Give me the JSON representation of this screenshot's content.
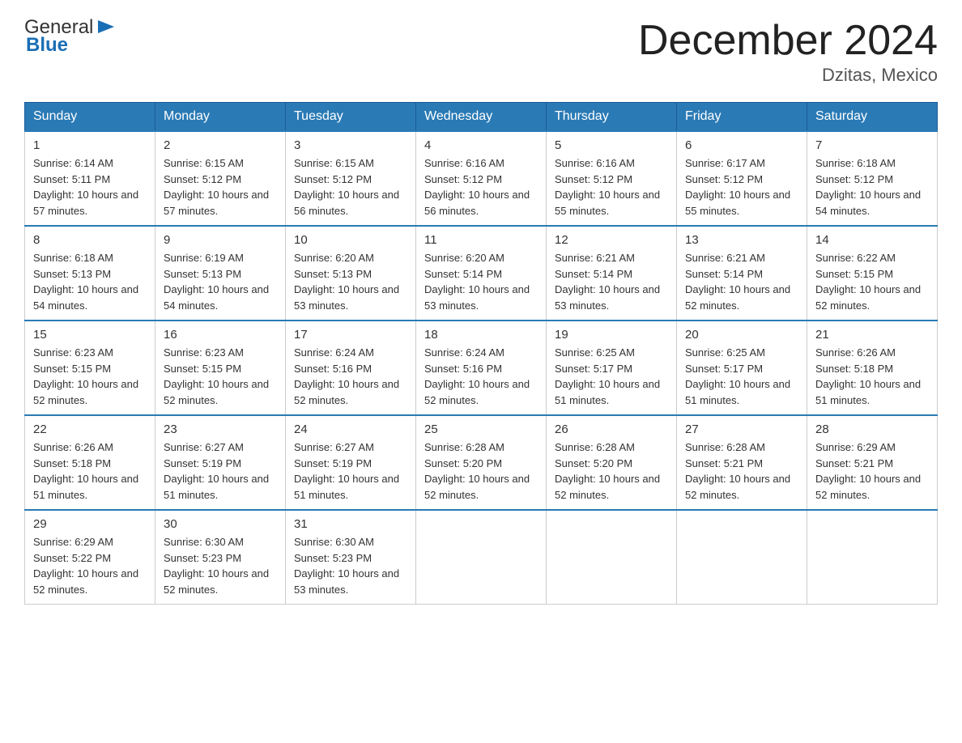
{
  "logo": {
    "general": "General",
    "blue": "Blue",
    "arrow_char": "▶"
  },
  "title": "December 2024",
  "location": "Dzitas, Mexico",
  "headers": [
    "Sunday",
    "Monday",
    "Tuesday",
    "Wednesday",
    "Thursday",
    "Friday",
    "Saturday"
  ],
  "weeks": [
    [
      {
        "day": "1",
        "sunrise": "6:14 AM",
        "sunset": "5:11 PM",
        "daylight": "10 hours and 57 minutes."
      },
      {
        "day": "2",
        "sunrise": "6:15 AM",
        "sunset": "5:12 PM",
        "daylight": "10 hours and 57 minutes."
      },
      {
        "day": "3",
        "sunrise": "6:15 AM",
        "sunset": "5:12 PM",
        "daylight": "10 hours and 56 minutes."
      },
      {
        "day": "4",
        "sunrise": "6:16 AM",
        "sunset": "5:12 PM",
        "daylight": "10 hours and 56 minutes."
      },
      {
        "day": "5",
        "sunrise": "6:16 AM",
        "sunset": "5:12 PM",
        "daylight": "10 hours and 55 minutes."
      },
      {
        "day": "6",
        "sunrise": "6:17 AM",
        "sunset": "5:12 PM",
        "daylight": "10 hours and 55 minutes."
      },
      {
        "day": "7",
        "sunrise": "6:18 AM",
        "sunset": "5:12 PM",
        "daylight": "10 hours and 54 minutes."
      }
    ],
    [
      {
        "day": "8",
        "sunrise": "6:18 AM",
        "sunset": "5:13 PM",
        "daylight": "10 hours and 54 minutes."
      },
      {
        "day": "9",
        "sunrise": "6:19 AM",
        "sunset": "5:13 PM",
        "daylight": "10 hours and 54 minutes."
      },
      {
        "day": "10",
        "sunrise": "6:20 AM",
        "sunset": "5:13 PM",
        "daylight": "10 hours and 53 minutes."
      },
      {
        "day": "11",
        "sunrise": "6:20 AM",
        "sunset": "5:14 PM",
        "daylight": "10 hours and 53 minutes."
      },
      {
        "day": "12",
        "sunrise": "6:21 AM",
        "sunset": "5:14 PM",
        "daylight": "10 hours and 53 minutes."
      },
      {
        "day": "13",
        "sunrise": "6:21 AM",
        "sunset": "5:14 PM",
        "daylight": "10 hours and 52 minutes."
      },
      {
        "day": "14",
        "sunrise": "6:22 AM",
        "sunset": "5:15 PM",
        "daylight": "10 hours and 52 minutes."
      }
    ],
    [
      {
        "day": "15",
        "sunrise": "6:23 AM",
        "sunset": "5:15 PM",
        "daylight": "10 hours and 52 minutes."
      },
      {
        "day": "16",
        "sunrise": "6:23 AM",
        "sunset": "5:15 PM",
        "daylight": "10 hours and 52 minutes."
      },
      {
        "day": "17",
        "sunrise": "6:24 AM",
        "sunset": "5:16 PM",
        "daylight": "10 hours and 52 minutes."
      },
      {
        "day": "18",
        "sunrise": "6:24 AM",
        "sunset": "5:16 PM",
        "daylight": "10 hours and 52 minutes."
      },
      {
        "day": "19",
        "sunrise": "6:25 AM",
        "sunset": "5:17 PM",
        "daylight": "10 hours and 51 minutes."
      },
      {
        "day": "20",
        "sunrise": "6:25 AM",
        "sunset": "5:17 PM",
        "daylight": "10 hours and 51 minutes."
      },
      {
        "day": "21",
        "sunrise": "6:26 AM",
        "sunset": "5:18 PM",
        "daylight": "10 hours and 51 minutes."
      }
    ],
    [
      {
        "day": "22",
        "sunrise": "6:26 AM",
        "sunset": "5:18 PM",
        "daylight": "10 hours and 51 minutes."
      },
      {
        "day": "23",
        "sunrise": "6:27 AM",
        "sunset": "5:19 PM",
        "daylight": "10 hours and 51 minutes."
      },
      {
        "day": "24",
        "sunrise": "6:27 AM",
        "sunset": "5:19 PM",
        "daylight": "10 hours and 51 minutes."
      },
      {
        "day": "25",
        "sunrise": "6:28 AM",
        "sunset": "5:20 PM",
        "daylight": "10 hours and 52 minutes."
      },
      {
        "day": "26",
        "sunrise": "6:28 AM",
        "sunset": "5:20 PM",
        "daylight": "10 hours and 52 minutes."
      },
      {
        "day": "27",
        "sunrise": "6:28 AM",
        "sunset": "5:21 PM",
        "daylight": "10 hours and 52 minutes."
      },
      {
        "day": "28",
        "sunrise": "6:29 AM",
        "sunset": "5:21 PM",
        "daylight": "10 hours and 52 minutes."
      }
    ],
    [
      {
        "day": "29",
        "sunrise": "6:29 AM",
        "sunset": "5:22 PM",
        "daylight": "10 hours and 52 minutes."
      },
      {
        "day": "30",
        "sunrise": "6:30 AM",
        "sunset": "5:23 PM",
        "daylight": "10 hours and 52 minutes."
      },
      {
        "day": "31",
        "sunrise": "6:30 AM",
        "sunset": "5:23 PM",
        "daylight": "10 hours and 53 minutes."
      },
      null,
      null,
      null,
      null
    ]
  ]
}
